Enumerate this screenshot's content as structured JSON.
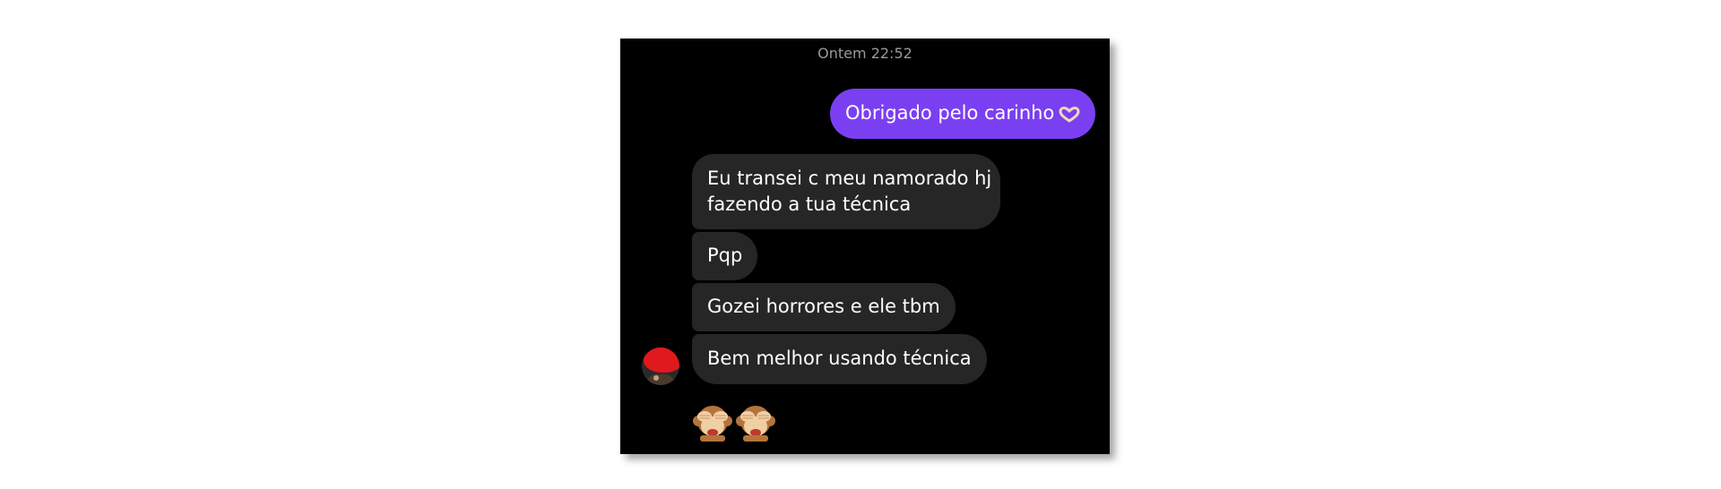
{
  "chat": {
    "timestamp": "Ontem 22:52",
    "outgoing_message": "Obrigado pelo carinho",
    "outgoing_emoji": "heart-hands-icon",
    "incoming_messages": [
      {
        "line1": "Eu transei c meu namorado hj",
        "line2": "fazendo a tua técnica"
      },
      {
        "text": "Pqp"
      },
      {
        "text": "Gozei horrores e ele tbm"
      },
      {
        "text": "Bem melhor usando técnica"
      }
    ],
    "reaction_emojis": [
      "see-no-evil-monkey-icon",
      "see-no-evil-monkey-icon"
    ]
  },
  "colors": {
    "outgoing_bubble": "#7b3ff2",
    "incoming_bubble": "#262626",
    "window_background": "#000000",
    "timestamp_text": "#9a9a9a",
    "avatar_accent": "#e0191c"
  }
}
